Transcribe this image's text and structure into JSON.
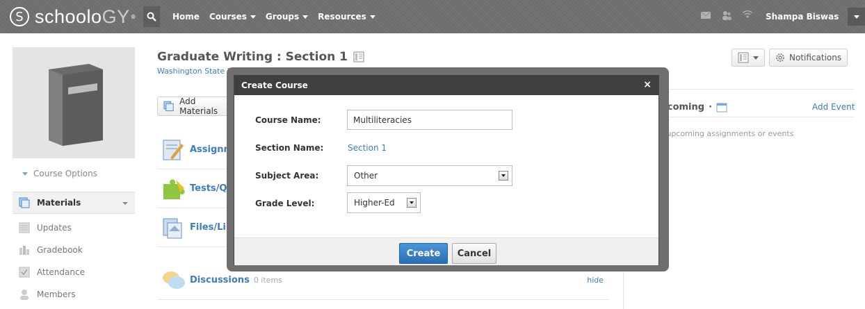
{
  "topbar": {
    "logo_letter": "S",
    "logo_text_main": "schoolo",
    "logo_text_accent": "GY",
    "logo_mark": "®",
    "nav": [
      {
        "label": "Home"
      },
      {
        "label": "Courses"
      },
      {
        "label": "Groups"
      },
      {
        "label": "Resources"
      }
    ],
    "user_name": "Shampa Biswas",
    "icons": [
      "search-icon",
      "mail-icon",
      "people-icon",
      "wireless-icon",
      "chevron-down-icon"
    ]
  },
  "sidebar": {
    "course_options": "Course Options",
    "items": [
      {
        "label": "Materials"
      },
      {
        "label": "Updates"
      },
      {
        "label": "Gradebook"
      },
      {
        "label": "Attendance"
      },
      {
        "label": "Members"
      }
    ]
  },
  "course": {
    "title": "Graduate Writing : Section 1",
    "subtitle": "Washington State University",
    "add_materials": "Add Materials"
  },
  "materials": [
    {
      "label": "Assignments",
      "count": "",
      "hide": ""
    },
    {
      "label": "Tests/Quizzes",
      "count": "",
      "hide": ""
    },
    {
      "label": "Files/Links",
      "count": "",
      "hide": ""
    },
    {
      "label": "Discussions",
      "count": "0 items",
      "hide": "hide"
    }
  ],
  "right": {
    "notifications": "Notifications",
    "upcoming_title": "Upcoming",
    "add_event": "Add Event",
    "no_upcoming": "No upcoming assignments or events"
  },
  "modal": {
    "title": "Create Course",
    "close": "×",
    "course_name_label": "Course Name:",
    "course_name_value": "Multiliteracies",
    "section_name_label": "Section Name:",
    "section_name_value": "Section 1",
    "subject_area_label": "Subject Area:",
    "subject_area_value": "Other",
    "grade_level_label": "Grade Level:",
    "grade_level_value": "Higher-Ed",
    "create_label": "Create",
    "cancel_label": "Cancel"
  },
  "colors": {
    "link": "#3c7cbf",
    "topbar": "#6f6f6f",
    "primary_button": "#2a6fb5",
    "modal_header": "#3f3f3f"
  }
}
